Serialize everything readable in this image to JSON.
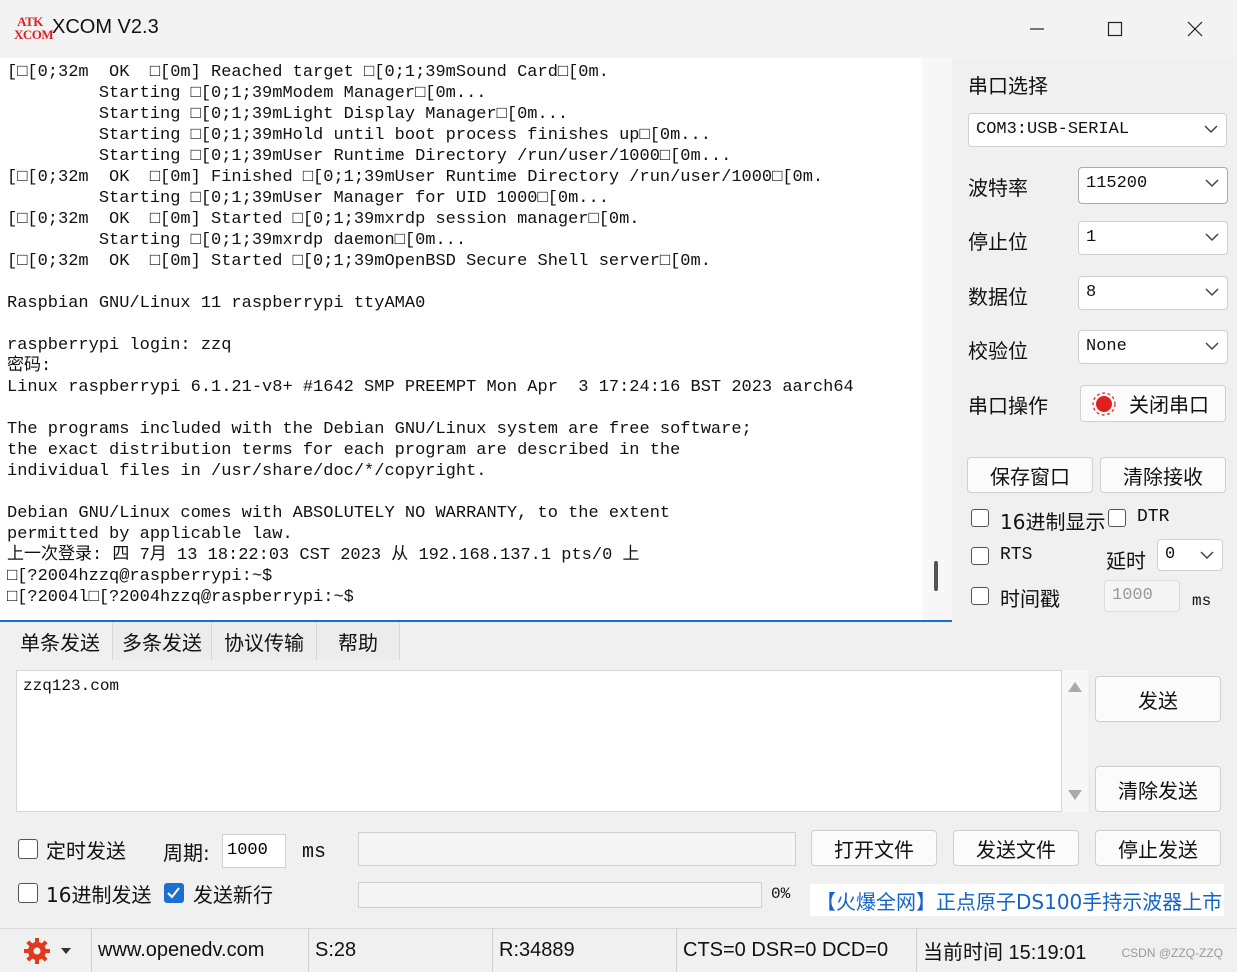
{
  "app": {
    "logo_top": "ATK",
    "logo_bottom": "XCOM",
    "title": "XCOM V2.3"
  },
  "terminal": {
    "lines": [
      "[□[0;32m  OK  □[0m] Reached target □[0;1;39mSound Card□[0m.",
      "         Starting □[0;1;39mModem Manager□[0m...",
      "         Starting □[0;1;39mLight Display Manager□[0m...",
      "         Starting □[0;1;39mHold until boot process finishes up□[0m...",
      "         Starting □[0;1;39mUser Runtime Directory /run/user/1000□[0m...",
      "[□[0;32m  OK  □[0m] Finished □[0;1;39mUser Runtime Directory /run/user/1000□[0m.",
      "         Starting □[0;1;39mUser Manager for UID 1000□[0m...",
      "[□[0;32m  OK  □[0m] Started □[0;1;39mxrdp session manager□[0m.",
      "         Starting □[0;1;39mxrdp daemon□[0m...",
      "[□[0;32m  OK  □[0m] Started □[0;1;39mOpenBSD Secure Shell server□[0m.",
      "",
      "Raspbian GNU/Linux 11 raspberrypi ttyAMA0",
      "",
      "raspberrypi login: zzq",
      "密码:",
      "Linux raspberrypi 6.1.21-v8+ #1642 SMP PREEMPT Mon Apr  3 17:24:16 BST 2023 aarch64",
      "",
      "The programs included with the Debian GNU/Linux system are free software;",
      "the exact distribution terms for each program are described in the",
      "individual files in /usr/share/doc/*/copyright.",
      "",
      "Debian GNU/Linux comes with ABSOLUTELY NO WARRANTY, to the extent",
      "permitted by applicable law.",
      "上一次登录: 四 7月 13 18:22:03 CST 2023 从 192.168.137.1 pts/0 上",
      "□[?2004hzzq@raspberrypi:~$",
      "□[?2004l□[?2004hzzq@raspberrypi:~$"
    ]
  },
  "settings": {
    "port_select_label": "串口选择",
    "port_value": "COM3:USB-SERIAL",
    "baud_label": "波特率",
    "baud_value": "115200",
    "stopbits_label": "停止位",
    "stopbits_value": "1",
    "databits_label": "数据位",
    "databits_value": "8",
    "parity_label": "校验位",
    "parity_value": "None",
    "port_op_label": "串口操作",
    "close_port_label": "关闭串口",
    "save_window_label": "保存窗口",
    "clear_receive_label": "清除接收",
    "hex_display_label": "16进制显示",
    "dtr_label": "DTR",
    "rts_label": "RTS",
    "delay_label": "延时",
    "delay_value": "0",
    "timestamp_label": "时间戳",
    "timestamp_value": "1000",
    "ms_label": "ms"
  },
  "tabs": [
    "单条发送",
    "多条发送",
    "协议传输",
    "帮助"
  ],
  "send": {
    "text": "zzq123.com",
    "send_button": "发送",
    "clear_send_button": "清除发送",
    "timed_send_label": "定时发送",
    "period_label": "周期:",
    "period_value": "1000",
    "period_unit": "ms",
    "open_file_button": "打开文件",
    "send_file_button": "发送文件",
    "stop_send_button": "停止发送",
    "hex_send_label": "16进制发送",
    "newline_label": "发送新行",
    "progress_percent": "0%",
    "progress_fraction": 0,
    "ad_text": "【火爆全网】正点原子DS100手持示波器上市"
  },
  "status": {
    "website": "www.openedv.com",
    "sent": "S:28",
    "received": "R:34889",
    "signals": "CTS=0 DSR=0 DCD=0",
    "time": "当前时间 15:19:01",
    "watermark": "CSDN @ZZQ-ZZQ"
  },
  "colors": {
    "accent": "#1a6fd0",
    "record_red": "#e02020",
    "ad_blue": "#1463c8"
  }
}
